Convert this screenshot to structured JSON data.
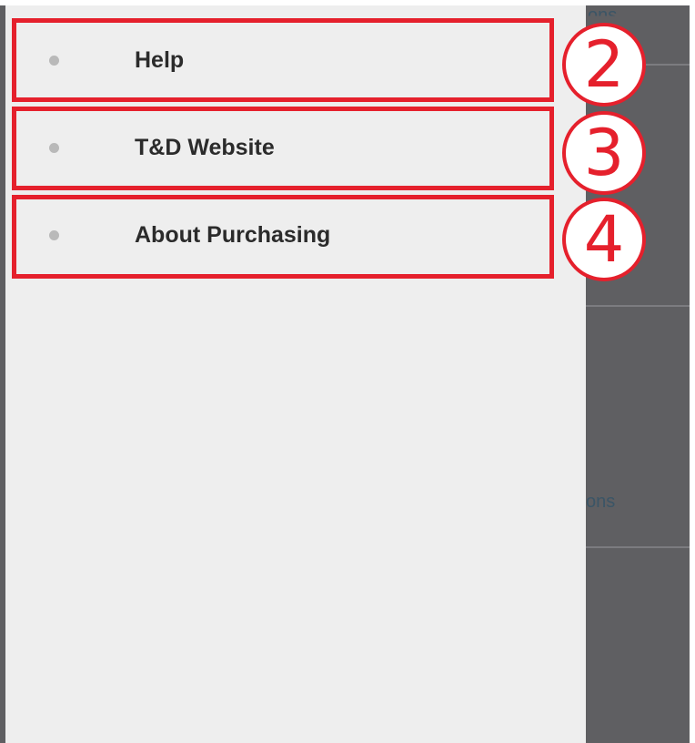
{
  "background_app": {
    "partial_text_top": "ons",
    "partial_text_middle": "ons"
  },
  "drawer": {
    "items": [
      {
        "label": "Help",
        "icon": "bullet-icon"
      },
      {
        "label": "T&D Website",
        "icon": "bullet-icon"
      },
      {
        "label": "About Purchasing",
        "icon": "bullet-icon"
      }
    ]
  },
  "annotations": {
    "numbers": [
      "2",
      "3",
      "4"
    ],
    "color": "#e5202c"
  },
  "colors": {
    "drawer_background": "#eeeeee",
    "scrim": "#5f5f62",
    "label_text": "#2b2b2b",
    "bullet": "#b9b9b9"
  }
}
